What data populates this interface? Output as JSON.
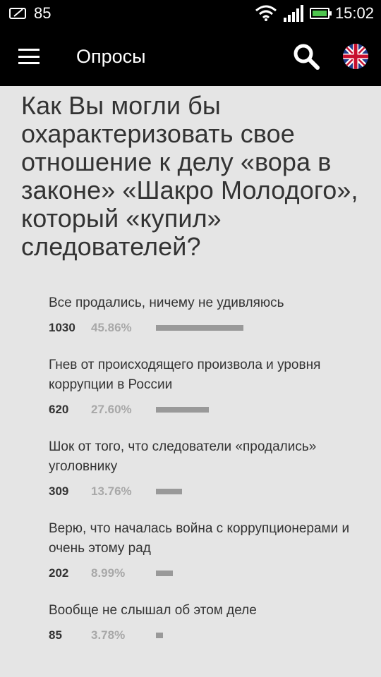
{
  "status_bar": {
    "notification_level": "85",
    "time": "15:02"
  },
  "app_bar": {
    "title": "Опросы",
    "menu_icon": "menu-icon",
    "search_icon": "search-icon",
    "language_icon": "uk-flag-icon"
  },
  "poll": {
    "question": "Как Вы могли бы охарактеризовать свое отношение к делу «вора в законе» «Шакро Молодого», который «купил» следователей?",
    "answers": [
      {
        "text": "Все продались, ничему не удивляюсь",
        "count": "1030",
        "percent": "45.86%",
        "share": 0.4586
      },
      {
        "text": "Гнев от происходящего произвола и уровня коррупции в России",
        "count": "620",
        "percent": "27.60%",
        "share": 0.276
      },
      {
        "text": "Шок от того, что следователи «продались» уголовнику",
        "count": "309",
        "percent": "13.76%",
        "share": 0.1376
      },
      {
        "text": "Верю, что началась война с коррупционерами и очень этому рад",
        "count": "202",
        "percent": "8.99%",
        "share": 0.0899
      },
      {
        "text": "Вообще не слышал об этом деле",
        "count": "85",
        "percent": "3.78%",
        "share": 0.0378
      }
    ]
  },
  "colors": {
    "background": "#e5e5e5",
    "bar": "#999999",
    "percent_text": "#a8a8a8",
    "header": "#000000"
  }
}
